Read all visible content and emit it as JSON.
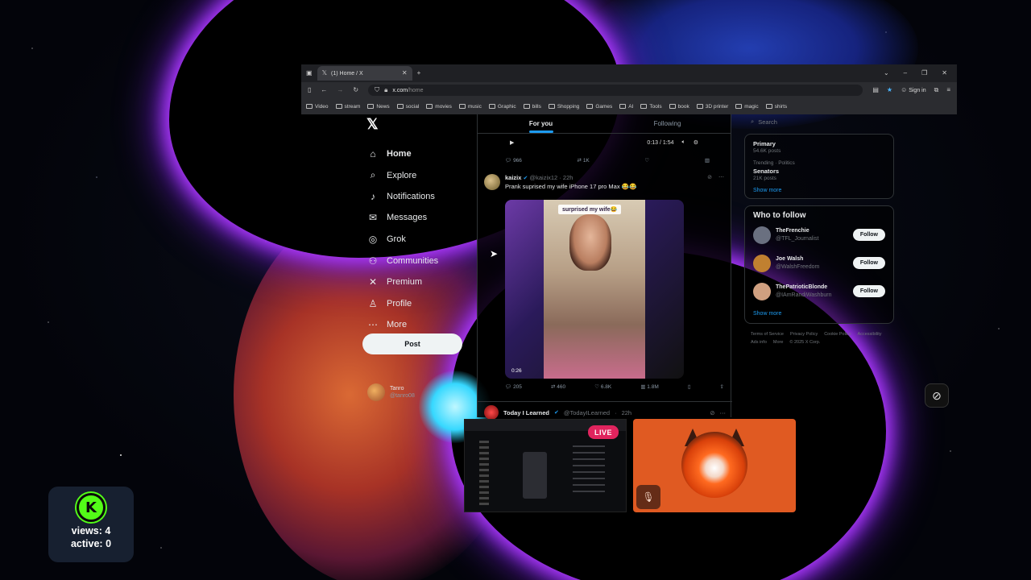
{
  "browser": {
    "tab_title": "(1) Home / X",
    "new_tab_icon": "plus-icon",
    "url_domain": "x.com",
    "url_path": "/home",
    "sign_in_label": "Sign in",
    "bookmarks": [
      "Video",
      "stream",
      "News",
      "social",
      "movies",
      "music",
      "Graphic",
      "bills",
      "Shopping",
      "Games",
      "AI",
      "Tools",
      "book",
      "3D printer",
      "magic",
      "shirts"
    ]
  },
  "nav": {
    "items": [
      {
        "label": "Home",
        "icon": "home-icon",
        "glyph": "⌂"
      },
      {
        "label": "Explore",
        "icon": "search-icon",
        "glyph": "⌕"
      },
      {
        "label": "Notifications",
        "icon": "bell-icon",
        "glyph": "♪"
      },
      {
        "label": "Messages",
        "icon": "mail-icon",
        "glyph": "✉"
      },
      {
        "label": "Grok",
        "icon": "grok-icon",
        "glyph": "◎"
      },
      {
        "label": "Communities",
        "icon": "people-icon",
        "glyph": "⚇"
      },
      {
        "label": "Premium",
        "icon": "x-icon",
        "glyph": "✕"
      },
      {
        "label": "Profile",
        "icon": "person-icon",
        "glyph": "♙"
      },
      {
        "label": "More",
        "icon": "more-icon",
        "glyph": "⋯"
      }
    ],
    "post_label": "Post",
    "account_name": "Tanro",
    "account_handle": "@tanro08"
  },
  "timeline": {
    "tabs": [
      "For you",
      "Following"
    ],
    "prev_player_time": "0:13 / 1:54",
    "prev_actions": [
      "966",
      "1K",
      "",
      ""
    ],
    "tweet": {
      "name": "kaizix",
      "handle": "@kaizix12",
      "time": "22h",
      "text": "Prank suprised my wife iPhone 17 pro Max 😂😂",
      "media_caption": "surprised my wife😂",
      "media_time": "0:26",
      "actions": [
        "205",
        "460",
        "6.8K",
        "1.8M"
      ]
    },
    "tweet2": {
      "name": "Today I Learned",
      "handle": "@TodayILearned",
      "time": "22h"
    }
  },
  "right": {
    "search_placeholder": "Search",
    "trends": [
      {
        "name": "Primary",
        "sub": "54.6K posts"
      },
      {
        "name": "Senators",
        "sub": "Trending · Politics",
        "sub2": "21K posts"
      }
    ],
    "trends_show_more": "Show more",
    "wtf_title": "Who to follow",
    "follow": [
      {
        "name": "TheFrenchie",
        "handle": "@TFL_Journalist",
        "button": "Follow",
        "color": "#6a7080"
      },
      {
        "name": "Joe Walsh",
        "handle": "@WalshFreedom",
        "button": "Follow",
        "color": "#c08030"
      },
      {
        "name": "ThePatrioticBlonde",
        "handle": "@IAmRandiWashburn",
        "button": "Follow",
        "color": "#d0a080"
      }
    ],
    "wtf_show_more": "Show more",
    "footer": [
      "Terms of Service",
      "Privacy Policy",
      "Cookie Policy",
      "Accessibility",
      "Ads info",
      "More",
      "© 2025 X Corp."
    ]
  },
  "overlay": {
    "live_label": "LIVE",
    "kick_letter": "K",
    "views_label": "views:",
    "views_value": "4",
    "active_label": "active:",
    "active_value": "0"
  }
}
